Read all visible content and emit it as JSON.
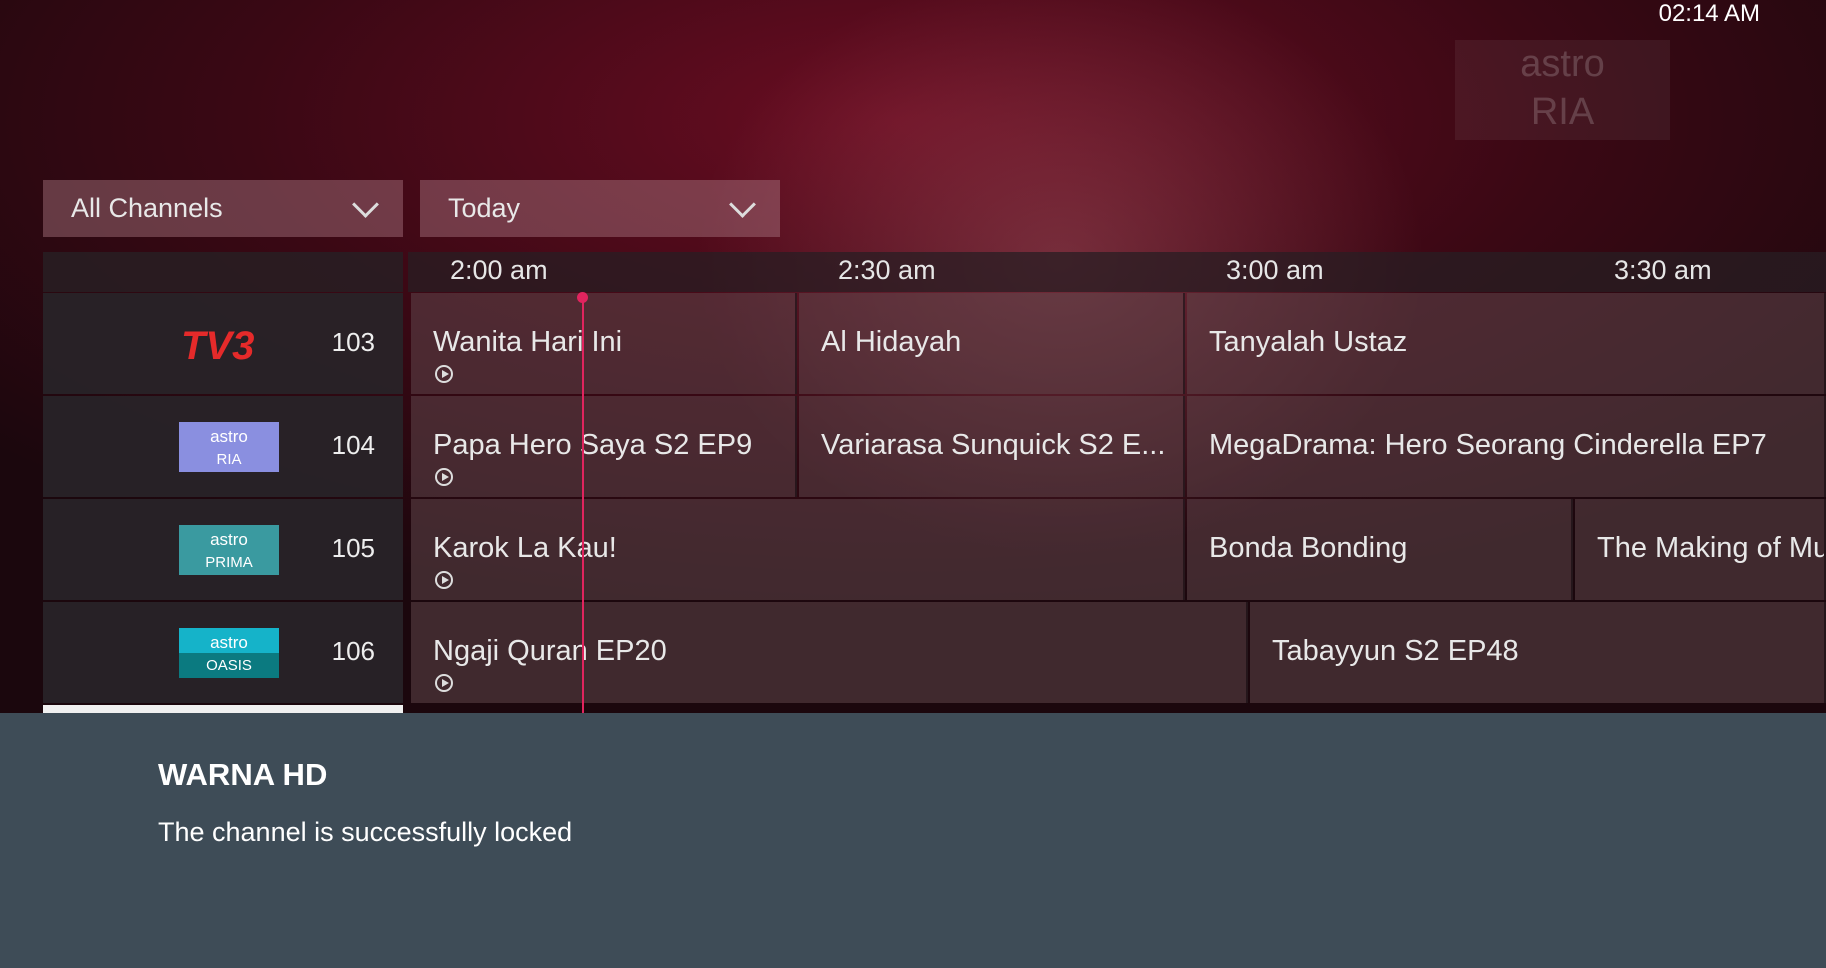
{
  "clock": "02:14 AM",
  "background_logo": {
    "line1": "astro",
    "line2": "RIA"
  },
  "filters": {
    "channels": "All Channels",
    "date": "Today"
  },
  "timeline": [
    "2:00 am",
    "2:30 am",
    "3:00 am",
    "3:30 am"
  ],
  "channels": [
    {
      "number": "103",
      "logo": "TV3",
      "programs": [
        {
          "title": "Wanita Hari Ini",
          "replay": true
        },
        {
          "title": "Al Hidayah",
          "replay": false
        },
        {
          "title": "Tanyalah Ustaz",
          "replay": false
        }
      ]
    },
    {
      "number": "104",
      "logo_line1": "astro",
      "logo_line2": "RIA",
      "logo_color": "#8a8fe0",
      "programs": [
        {
          "title": "Papa Hero Saya S2 EP9",
          "replay": true
        },
        {
          "title": "Variarasa Sunquick S2 E...",
          "replay": false
        },
        {
          "title": "MegaDrama: Hero Seorang Cinderella EP7",
          "replay": false
        }
      ]
    },
    {
      "number": "105",
      "logo_line1": "astro",
      "logo_line2": "PRIMA",
      "logo_color": "#3a9aa0",
      "programs": [
        {
          "title": "Karok La Kau!",
          "replay": true
        },
        {
          "title": "Bonda Bonding",
          "replay": false
        },
        {
          "title": "The Making of Mu",
          "replay": false
        }
      ]
    },
    {
      "number": "106",
      "logo_line1": "astro",
      "logo_line2": "OASIS",
      "logo_color": "#15b3c9",
      "programs": [
        {
          "title": "Ngaji Quran EP20",
          "replay": true
        },
        {
          "title": "Tabayyun S2 EP48",
          "replay": false
        }
      ]
    }
  ],
  "toast": {
    "title": "WARNA HD",
    "message": "The channel is successfully locked"
  }
}
